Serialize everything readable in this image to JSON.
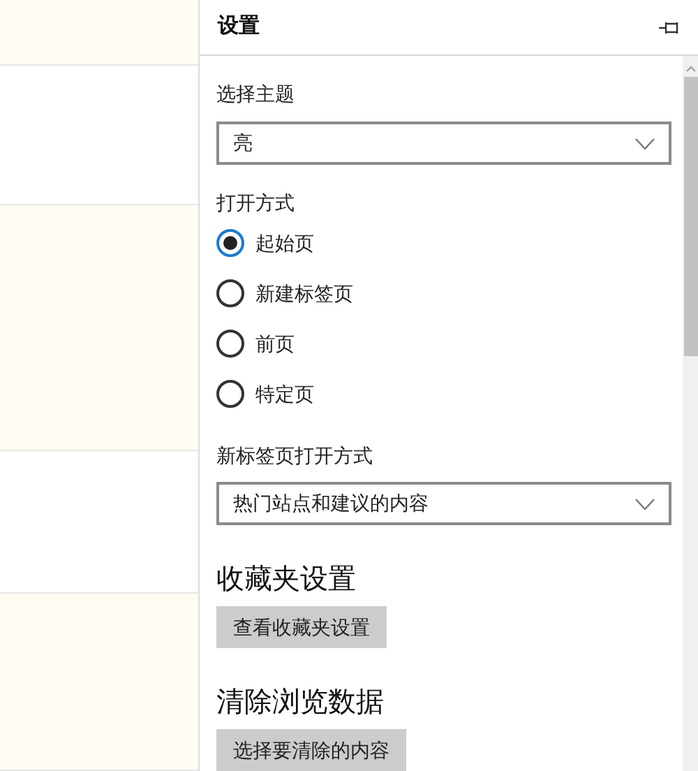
{
  "panel": {
    "title": "设置"
  },
  "theme": {
    "label": "选择主题",
    "value": "亮"
  },
  "open_with": {
    "label": "打开方式",
    "options": [
      {
        "label": "起始页",
        "selected": true
      },
      {
        "label": "新建标签页",
        "selected": false
      },
      {
        "label": "前页",
        "selected": false
      },
      {
        "label": "特定页",
        "selected": false
      }
    ]
  },
  "new_tab": {
    "label": "新标签页打开方式",
    "value": "热门站点和建议的内容"
  },
  "sections": [
    {
      "heading": "收藏夹设置",
      "button": "查看收藏夹设置"
    },
    {
      "heading": "清除浏览数据",
      "button": "选择要清除的内容"
    }
  ]
}
